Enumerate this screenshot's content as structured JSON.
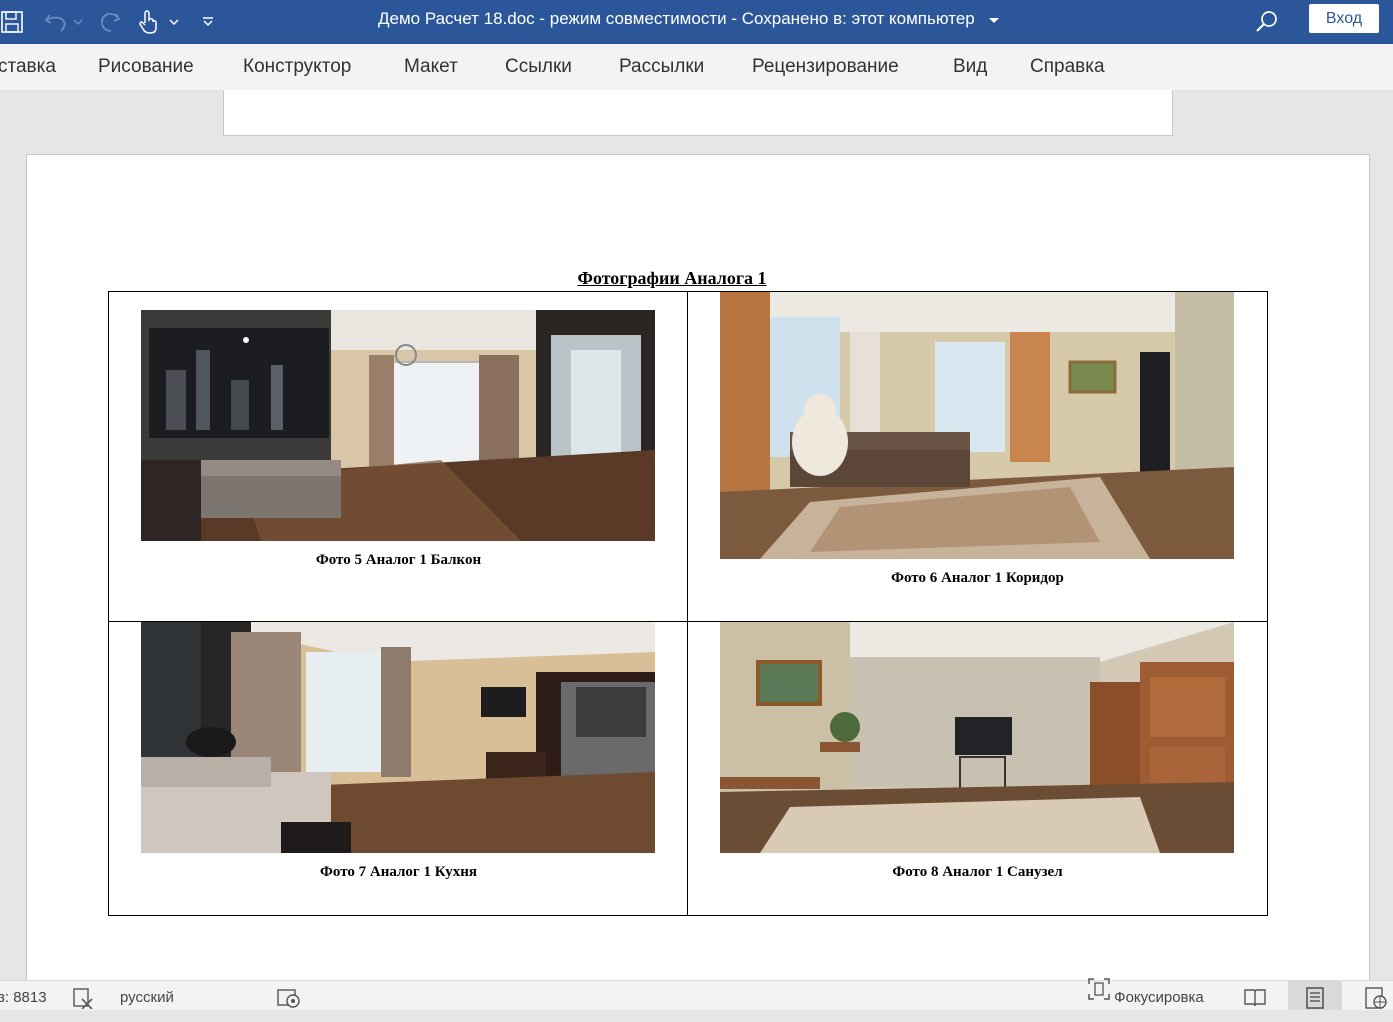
{
  "titlebar": {
    "title": "Демо Расчет 18.doc  -  режим совместимости  -  Сохранено в: этот компьютер",
    "login_label": "Вход",
    "icons": [
      "save-icon",
      "undo-icon",
      "redo-icon",
      "touch-mode-icon",
      "customize-qat-icon",
      "search-icon"
    ],
    "background": "#2b579a"
  },
  "ribbon": {
    "tabs": [
      "ставка",
      "Рисование",
      "Конструктор",
      "Макет",
      "Ссылки",
      "Рассылки",
      "Рецензирование",
      "Вид",
      "Справка"
    ]
  },
  "document": {
    "title": "Фотографии Аналога 1",
    "photos": [
      {
        "caption": "Фото 5 Аналог 1 Балкон"
      },
      {
        "caption": "Фото 6 Аналог 1 Коридор"
      },
      {
        "caption": "Фото 7 Аналог 1 Кухня"
      },
      {
        "caption": "Фото 8 Аналог 1 Санузел"
      }
    ]
  },
  "statusbar": {
    "word_count": "з: 8813",
    "language": "русский",
    "focus_label": "Фокусировка"
  }
}
